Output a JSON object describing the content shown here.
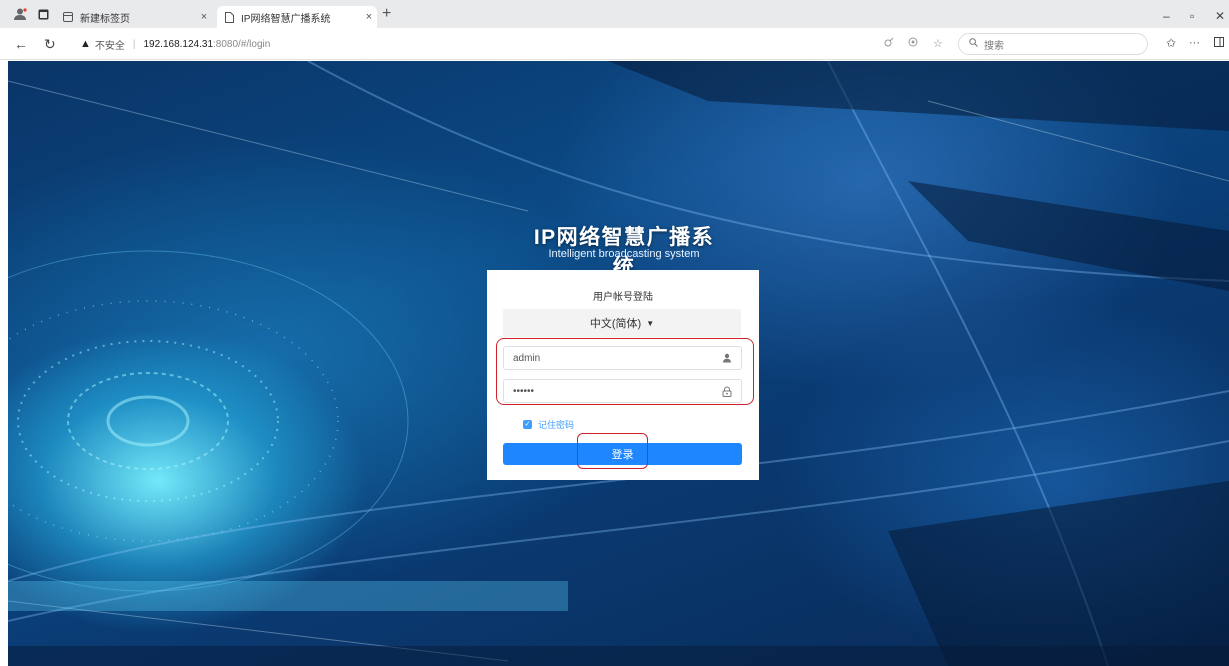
{
  "browser": {
    "tabs": [
      {
        "title": "新建标签页",
        "active": false
      },
      {
        "title": "IP网络智慧广播系统",
        "active": true
      }
    ],
    "tab_close_glyph": "×",
    "new_tab_glyph": "+",
    "window_controls": {
      "minimize": "–",
      "restore": "▫",
      "close": "✕"
    },
    "security_warning": "不安全",
    "url_host": "192.168.124.31",
    "url_path": ":8080/#/login",
    "search_placeholder": "搜索",
    "more_glyph": "···",
    "icons": [
      "profile-icon",
      "tab-actions-icon",
      "workspaces-icon",
      "page-icon",
      "back-icon",
      "refresh-icon",
      "warning-icon",
      "read-aloud-icon",
      "extensions-icon",
      "favorite-star-icon",
      "search-icon",
      "favorites-icon",
      "more-icon",
      "sidebar-icon"
    ]
  },
  "login": {
    "title": "IP网络智慧广播系统",
    "subtitle": "Intelligent broadcasting system",
    "card_title": "用户帐号登陆",
    "language": "中文(简体)",
    "username": "admin",
    "password": "••••••",
    "remember_label": "记住密码",
    "remember_checked": true,
    "submit_label": "登录"
  },
  "colors": {
    "accent": "#1e86ff",
    "highlight": "#d0222a",
    "link": "#409eff",
    "background": "#0b4a86"
  }
}
